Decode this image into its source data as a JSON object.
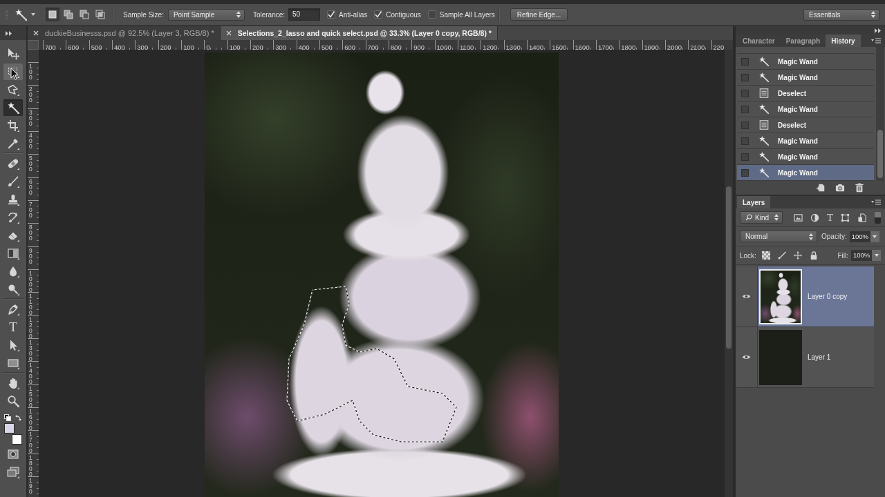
{
  "options_bar": {
    "selection_modes": [
      {
        "kind": "new",
        "selected": true
      },
      {
        "kind": "add",
        "selected": false
      },
      {
        "kind": "subtract",
        "selected": false
      },
      {
        "kind": "intersect",
        "selected": false
      }
    ],
    "sample_size": {
      "label": "Sample Size:",
      "value": "Point Sample"
    },
    "tolerance": {
      "label": "Tolerance:",
      "value": "50"
    },
    "checkboxes": [
      {
        "label": "Anti-alias",
        "checked": true
      },
      {
        "label": "Contiguous",
        "checked": true
      },
      {
        "label": "Sample All Layers",
        "checked": false
      }
    ],
    "refine_button": "Refine Edge...",
    "workspace": "Essentials"
  },
  "tool_groups": [
    [
      {
        "kind": "move",
        "selected": false,
        "hovered": false
      },
      {
        "kind": "marquee",
        "selected": false,
        "hovered": true
      },
      {
        "kind": "lasso",
        "selected": false,
        "hovered": false
      },
      {
        "kind": "wand",
        "selected": true,
        "hovered": false
      },
      {
        "kind": "crop",
        "selected": false,
        "hovered": false
      },
      {
        "kind": "eyedropper",
        "selected": false,
        "hovered": false
      }
    ],
    [
      {
        "kind": "healing",
        "selected": false,
        "hovered": false
      },
      {
        "kind": "brush",
        "selected": false,
        "hovered": false
      },
      {
        "kind": "stamp",
        "selected": false,
        "hovered": false
      },
      {
        "kind": "history_brush",
        "selected": false,
        "hovered": false
      },
      {
        "kind": "eraser",
        "selected": false,
        "hovered": false
      },
      {
        "kind": "gradient",
        "selected": false,
        "hovered": false
      },
      {
        "kind": "blur",
        "selected": false,
        "hovered": false
      },
      {
        "kind": "dodge",
        "selected": false,
        "hovered": false
      }
    ],
    [
      {
        "kind": "pen",
        "selected": false,
        "hovered": false
      },
      {
        "kind": "type",
        "glyph": "T",
        "selected": false,
        "hovered": false
      },
      {
        "kind": "path_select",
        "selected": false,
        "hovered": false
      },
      {
        "kind": "shape",
        "selected": false,
        "hovered": false
      }
    ],
    [
      {
        "kind": "hand",
        "selected": false,
        "hovered": false
      },
      {
        "kind": "zoom",
        "selected": false,
        "hovered": false
      }
    ]
  ],
  "color_swatches": [
    {
      "kind": "foreground",
      "color": "#d9d6e9"
    },
    {
      "kind": "background",
      "color": "#ffffff"
    }
  ],
  "document_tabs": [
    {
      "title": "duckieBusinesss.psd @ 92.5% (Layer 3, RGB/8) *",
      "selected": false
    },
    {
      "title": "Selections_2_lasso and quick select.psd @ 33.3% (Layer 0 copy, RGB/8) *",
      "selected": true
    }
  ],
  "rulers": {
    "horizontal": [
      "700",
      "600",
      "500",
      "400",
      "300",
      "200",
      "100",
      "0",
      "100",
      "200",
      "300",
      "400",
      "500",
      "600",
      "700",
      "800",
      "900",
      "1000",
      "1100",
      "1200",
      "1300",
      "1400",
      "1500",
      "1600",
      "1700",
      "1800",
      "1900",
      "2000",
      "2100",
      "220"
    ],
    "vertical": [
      "100",
      "200",
      "300",
      "400",
      "500",
      "600",
      "700",
      "800",
      "900",
      "1000",
      "1100",
      "1200",
      "1300",
      "1400",
      "1500",
      "1600",
      "1700",
      "1800",
      "190"
    ]
  },
  "history_panel": {
    "tabs": [
      {
        "label": "Character",
        "selected": false
      },
      {
        "label": "Paragraph",
        "selected": false
      },
      {
        "label": "History",
        "selected": true
      }
    ],
    "states": [
      {
        "kind": "wand",
        "label": "Magic Wand",
        "checked": false,
        "selected": false
      },
      {
        "kind": "wand",
        "label": "Magic Wand",
        "checked": false,
        "selected": false
      },
      {
        "kind": "deselect",
        "label": "Deselect",
        "checked": false,
        "selected": false
      },
      {
        "kind": "wand",
        "label": "Magic Wand",
        "checked": false,
        "selected": false
      },
      {
        "kind": "deselect",
        "label": "Deselect",
        "checked": false,
        "selected": false
      },
      {
        "kind": "wand",
        "label": "Magic Wand",
        "checked": false,
        "selected": false
      },
      {
        "kind": "wand",
        "label": "Magic Wand",
        "checked": false,
        "selected": false
      },
      {
        "kind": "wand",
        "label": "Magic Wand",
        "checked": false,
        "selected": true
      }
    ]
  },
  "layers_panel": {
    "tabs": [
      {
        "label": "Layers",
        "selected": true
      }
    ],
    "filter": {
      "value": "Kind",
      "icons": [
        {
          "kind": "pixel"
        },
        {
          "kind": "adjustment"
        },
        {
          "kind": "type",
          "glyph": "T"
        },
        {
          "kind": "shape"
        },
        {
          "kind": "smart"
        }
      ],
      "on": true
    },
    "blend_mode": "Normal",
    "opacity": {
      "label": "Opacity:",
      "value": "100%"
    },
    "lock": {
      "label": "Lock:"
    },
    "fill": {
      "label": "Fill:",
      "value": "100%"
    },
    "layers": [
      {
        "name": "Layer 0 copy",
        "kind": "photo",
        "visible": true,
        "selected": true
      },
      {
        "name": "Layer 1",
        "kind": "solid",
        "visible": true,
        "selected": false
      }
    ]
  }
}
